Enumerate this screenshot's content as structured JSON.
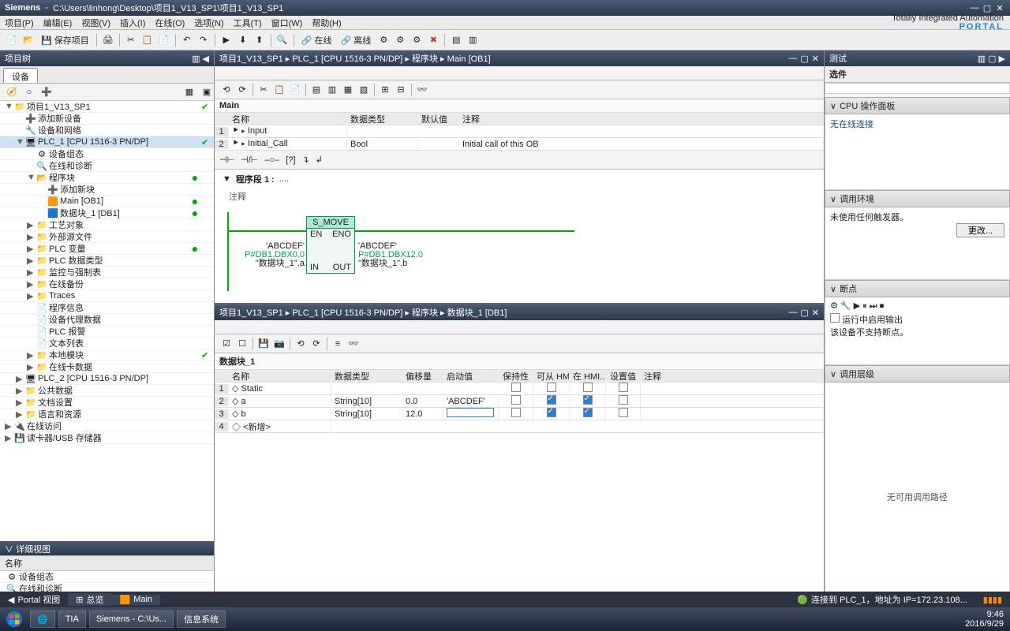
{
  "title": {
    "vendor": "Siemens",
    "path": "C:\\Users\\linhong\\Desktop\\项目1_V13_SP1\\项目1_V13_SP1"
  },
  "menu": [
    "项目(P)",
    "编辑(E)",
    "视图(V)",
    "插入(I)",
    "在线(O)",
    "选项(N)",
    "工具(T)",
    "窗口(W)",
    "帮助(H)"
  ],
  "brand": {
    "l1": "Totally Integrated Automation",
    "l2": "PORTAL"
  },
  "toolbar": {
    "save": "保存项目",
    "online": "在线",
    "offline": "离线"
  },
  "left": {
    "panel": "项目树",
    "tab": "设备",
    "detail_header": "详细视图",
    "detail_col": "名称",
    "detail_rows": [
      "设备组态",
      "在线和诊断"
    ],
    "tree": [
      {
        "d": 0,
        "exp": "▼",
        "ico": "📁",
        "lbl": "项目1_V13_SP1",
        "chk": "✔"
      },
      {
        "d": 1,
        "exp": "",
        "ico": "➕",
        "lbl": "添加新设备"
      },
      {
        "d": 1,
        "exp": "",
        "ico": "🔧",
        "lbl": "设备和网络"
      },
      {
        "d": 1,
        "exp": "▼",
        "ico": "🖥",
        "lbl": "PLC_1 [CPU 1516-3 PN/DP]",
        "sel": true,
        "chk": "✔"
      },
      {
        "d": 2,
        "exp": "",
        "ico": "⚙",
        "lbl": "设备组态"
      },
      {
        "d": 2,
        "exp": "",
        "ico": "🔍",
        "lbl": "在线和诊断"
      },
      {
        "d": 2,
        "exp": "▼",
        "ico": "📂",
        "lbl": "程序块",
        "dot": "●"
      },
      {
        "d": 3,
        "exp": "",
        "ico": "➕",
        "lbl": "添加新块"
      },
      {
        "d": 3,
        "exp": "",
        "ico": "🟧",
        "lbl": "Main [OB1]",
        "dot": "●"
      },
      {
        "d": 3,
        "exp": "",
        "ico": "🟦",
        "lbl": "数据块_1 [DB1]",
        "dot": "●"
      },
      {
        "d": 2,
        "exp": "▶",
        "ico": "📁",
        "lbl": "工艺对象"
      },
      {
        "d": 2,
        "exp": "▶",
        "ico": "📁",
        "lbl": "外部源文件"
      },
      {
        "d": 2,
        "exp": "▶",
        "ico": "📁",
        "lbl": "PLC 变量",
        "dot": "●"
      },
      {
        "d": 2,
        "exp": "▶",
        "ico": "📁",
        "lbl": "PLC 数据类型"
      },
      {
        "d": 2,
        "exp": "▶",
        "ico": "📁",
        "lbl": "监控与强制表"
      },
      {
        "d": 2,
        "exp": "▶",
        "ico": "📁",
        "lbl": "在线备份"
      },
      {
        "d": 2,
        "exp": "▶",
        "ico": "📁",
        "lbl": "Traces"
      },
      {
        "d": 2,
        "exp": "",
        "ico": "📄",
        "lbl": "程序信息"
      },
      {
        "d": 2,
        "exp": "",
        "ico": "📄",
        "lbl": "设备代理数据"
      },
      {
        "d": 2,
        "exp": "",
        "ico": "📄",
        "lbl": "PLC 报警"
      },
      {
        "d": 2,
        "exp": "",
        "ico": "📄",
        "lbl": "文本列表"
      },
      {
        "d": 2,
        "exp": "▶",
        "ico": "📁",
        "lbl": "本地模块",
        "chk": "✔"
      },
      {
        "d": 2,
        "exp": "▶",
        "ico": "📁",
        "lbl": "在线卡数据"
      },
      {
        "d": 1,
        "exp": "▶",
        "ico": "🖥",
        "lbl": "PLC_2 [CPU 1516-3 PN/DP]"
      },
      {
        "d": 1,
        "exp": "▶",
        "ico": "📁",
        "lbl": "公共数据"
      },
      {
        "d": 1,
        "exp": "▶",
        "ico": "📁",
        "lbl": "文档设置"
      },
      {
        "d": 1,
        "exp": "▶",
        "ico": "📁",
        "lbl": "语言和资源"
      },
      {
        "d": 0,
        "exp": "▶",
        "ico": "🔌",
        "lbl": "在线访问"
      },
      {
        "d": 0,
        "exp": "▶",
        "ico": "💾",
        "lbl": "读卡器/USB 存储器"
      }
    ]
  },
  "editor_top": {
    "crumb": "项目1_V13_SP1  ▸  PLC_1 [CPU 1516-3 PN/DP]  ▸  程序块  ▸  Main [OB1]",
    "title": "Main",
    "cols": [
      "名称",
      "数据类型",
      "默认值",
      "注释"
    ],
    "rows": [
      {
        "i": "1",
        "n": "Input",
        "dt": "",
        "def": "",
        "cm": ""
      },
      {
        "i": "2",
        "n": "Initial_Call",
        "dt": "Bool",
        "def": "",
        "cm": "Initial call of this OB"
      }
    ],
    "segment": "程序段 1 :",
    "sub": "注释",
    "box": {
      "name": "S_MOVE",
      "en": "EN",
      "eno": "ENO",
      "in": "IN",
      "out": "OUT"
    },
    "left_op": {
      "l1": "'ABCDEF'",
      "l2": "P#DB1.DBX0.0",
      "l3": "\"数据块_1\".a"
    },
    "right_op": {
      "l1": "'ABCDEF'",
      "l2": "P#DB1.DBX12.0",
      "l3": "\"数据块_1\".b"
    }
  },
  "editor_bottom": {
    "crumb": "项目1_V13_SP1  ▸  PLC_1 [CPU 1516-3 PN/DP]  ▸  程序块  ▸  数据块_1 [DB1]",
    "title": "数据块_1",
    "cols": [
      "名称",
      "数据类型",
      "偏移量",
      "启动值",
      "保持性",
      "可从 HMI...",
      "在 HMI...",
      "设置值",
      "注释"
    ],
    "rows": [
      {
        "i": "1",
        "n": "Static",
        "dt": "",
        "off": "",
        "sv": "",
        "k": false,
        "h1": false,
        "h2": false,
        "sz": false
      },
      {
        "i": "2",
        "n": "a",
        "dt": "String[10]",
        "off": "0.0",
        "sv": "'ABCDEF'",
        "k": false,
        "h1": true,
        "h2": true,
        "sz": false
      },
      {
        "i": "3",
        "n": "b",
        "dt": "String[10]",
        "off": "12.0",
        "sv": "",
        "k": false,
        "h1": true,
        "h2": true,
        "sz": false,
        "editing": true
      },
      {
        "i": "4",
        "n": "<新增>",
        "dt": "",
        "off": "",
        "sv": "",
        "blank": true
      }
    ]
  },
  "right": {
    "panel_title": "测试",
    "options": "选件",
    "sec1": {
      "title": "CPU 操作面板",
      "body": "无在线连接"
    },
    "sec2": {
      "title": "调用环境",
      "body": "未使用任何触发器。",
      "btn": "更改..."
    },
    "sec3": {
      "title": "断点",
      "row1": "运行中启用输出",
      "row2": "该设备不支持断点。"
    },
    "sec4": {
      "title": "调用层级",
      "body": "无可用调用路径"
    }
  },
  "status": {
    "portal": "Portal 视图",
    "overview": "总览",
    "main": "Main",
    "right": "连接到 PLC_1，地址为 IP=172.23.108..."
  },
  "wtask": {
    "items": [
      "Siemens  -  C:\\Us...",
      "信息系统"
    ],
    "time": "9:46",
    "date": "2016/9/29"
  }
}
